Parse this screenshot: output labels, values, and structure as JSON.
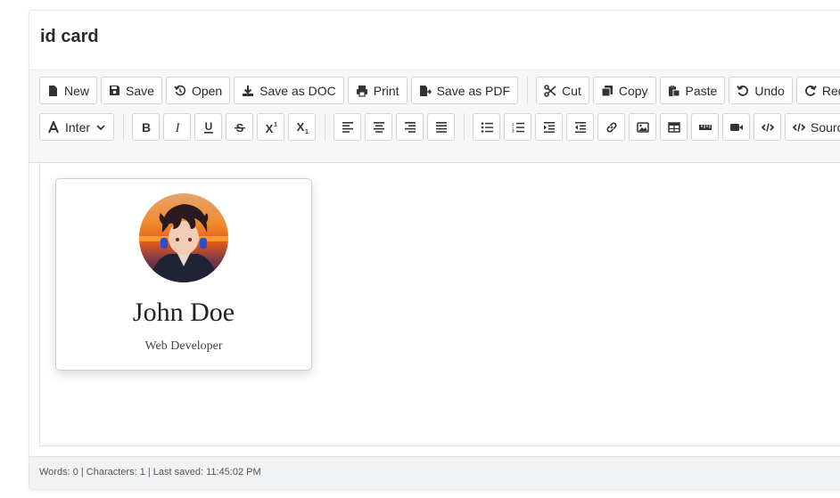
{
  "document": {
    "title": "id card"
  },
  "toolbar": {
    "row1": [
      {
        "name": "new-button",
        "icon": "file-icon",
        "label": "New"
      },
      {
        "name": "save-button",
        "icon": "floppy-disk-icon",
        "label": "Save"
      },
      {
        "name": "open-button",
        "icon": "history-icon",
        "label": "Open"
      },
      {
        "name": "save-as-doc-button",
        "icon": "download-icon",
        "label": "Save as DOC"
      },
      {
        "name": "print-button",
        "icon": "printer-icon",
        "label": "Print"
      },
      {
        "name": "save-as-pdf-button",
        "icon": "file-export-icon",
        "label": "Save as PDF"
      },
      {
        "sep": true
      },
      {
        "name": "cut-button",
        "icon": "scissors-icon",
        "label": "Cut"
      },
      {
        "name": "copy-button",
        "icon": "copy-icon",
        "label": "Copy"
      },
      {
        "name": "paste-button",
        "icon": "paste-icon",
        "label": "Paste"
      },
      {
        "name": "undo-button",
        "icon": "undo-icon",
        "label": "Undo"
      },
      {
        "name": "redo-button",
        "icon": "redo-icon",
        "label": "Redo"
      },
      {
        "name": "clipped-button",
        "icon": "document-icon",
        "label": ""
      }
    ],
    "font_select": {
      "icon": "font-icon",
      "label": "Inter"
    },
    "row2": [
      {
        "name": "bold-button",
        "icon": "bold-icon"
      },
      {
        "name": "italic-button",
        "icon": "italic-icon"
      },
      {
        "name": "underline-button",
        "icon": "underline-icon"
      },
      {
        "name": "strikethrough-button",
        "icon": "strikethrough-icon"
      },
      {
        "name": "superscript-button",
        "icon": "superscript-icon"
      },
      {
        "name": "subscript-button",
        "icon": "subscript-icon"
      },
      {
        "sep": true
      },
      {
        "name": "align-left-button",
        "icon": "align-left-icon"
      },
      {
        "name": "align-center-button",
        "icon": "align-center-icon"
      },
      {
        "name": "align-right-button",
        "icon": "align-right-icon"
      },
      {
        "name": "align-justify-button",
        "icon": "align-justify-icon"
      },
      {
        "sep": true
      },
      {
        "name": "bulleted-list-button",
        "icon": "bulleted-list-icon"
      },
      {
        "name": "numbered-list-button",
        "icon": "numbered-list-icon"
      },
      {
        "name": "indent-button",
        "icon": "indent-icon"
      },
      {
        "name": "outdent-button",
        "icon": "outdent-icon"
      },
      {
        "name": "insert-link-button",
        "icon": "link-icon"
      },
      {
        "name": "insert-image-button",
        "icon": "image-icon"
      },
      {
        "name": "insert-table-button",
        "icon": "table-icon"
      },
      {
        "name": "horizontal-rule-button",
        "icon": "ruler-icon"
      },
      {
        "name": "insert-video-button",
        "icon": "video-icon"
      },
      {
        "name": "embed-code-button",
        "icon": "code-icon"
      },
      {
        "name": "source-button",
        "icon": "code-icon",
        "label": "Source"
      }
    ]
  },
  "card": {
    "name": "John Doe",
    "role": "Web Developer",
    "avatar_icon": "anime-avatar-photo"
  },
  "status": {
    "text": "Words: 0 | Characters: 1 | Last saved: 11:45:02 PM"
  }
}
